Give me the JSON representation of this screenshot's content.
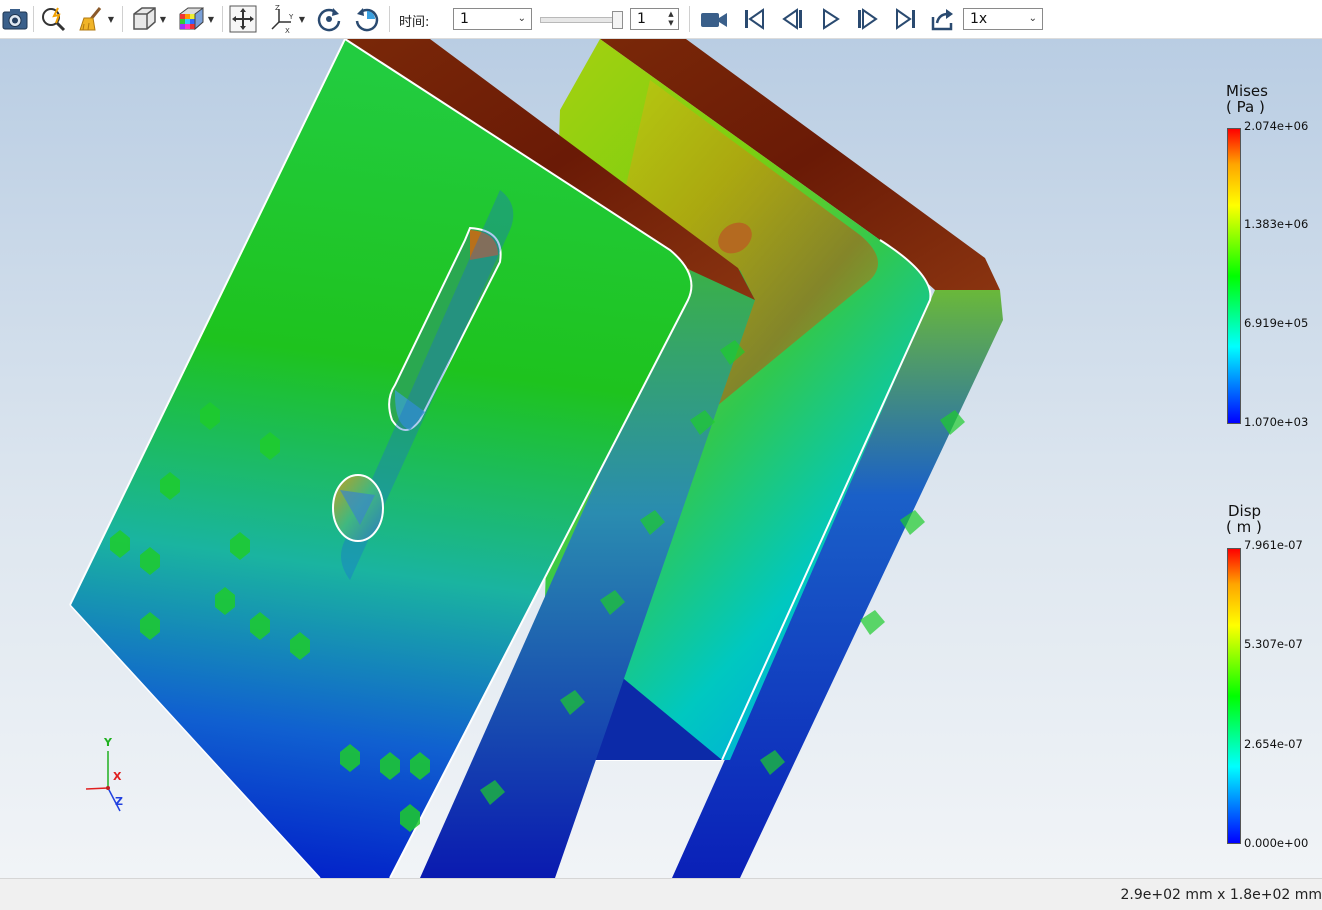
{
  "toolbar": {
    "time_label": "时间:",
    "time_select_value": "1",
    "frame_spin_value": "1",
    "speed_select_value": "1x"
  },
  "legend_mises": {
    "title": "Mises",
    "unit": "( Pa )",
    "ticks": [
      "2.074e+06",
      "1.383e+06",
      "6.919e+05",
      "1.070e+03"
    ]
  },
  "legend_disp": {
    "title": "Disp",
    "unit": "( m )",
    "ticks": [
      "7.961e-07",
      "5.307e-07",
      "2.654e-07",
      "0.000e+00"
    ]
  },
  "axes": {
    "x": "X",
    "y": "Y",
    "z": "Z"
  },
  "status": {
    "dimensions": "2.9e+02 mm x 1.8e+02 mm"
  },
  "colors": {
    "axis_x": "#e02020",
    "axis_y": "#20b020",
    "axis_z": "#2040e0"
  },
  "icons": [
    "camera-icon",
    "zoom-fit-icon",
    "clear-brush-icon",
    "view-cube-icon",
    "color-cube-icon",
    "pan-icon",
    "axis-orient-icon",
    "rotate-cw-icon",
    "rotate-ccw-icon",
    "video-record-icon",
    "skip-first-icon",
    "step-back-icon",
    "play-icon",
    "step-forward-icon",
    "skip-last-icon",
    "export-icon"
  ]
}
